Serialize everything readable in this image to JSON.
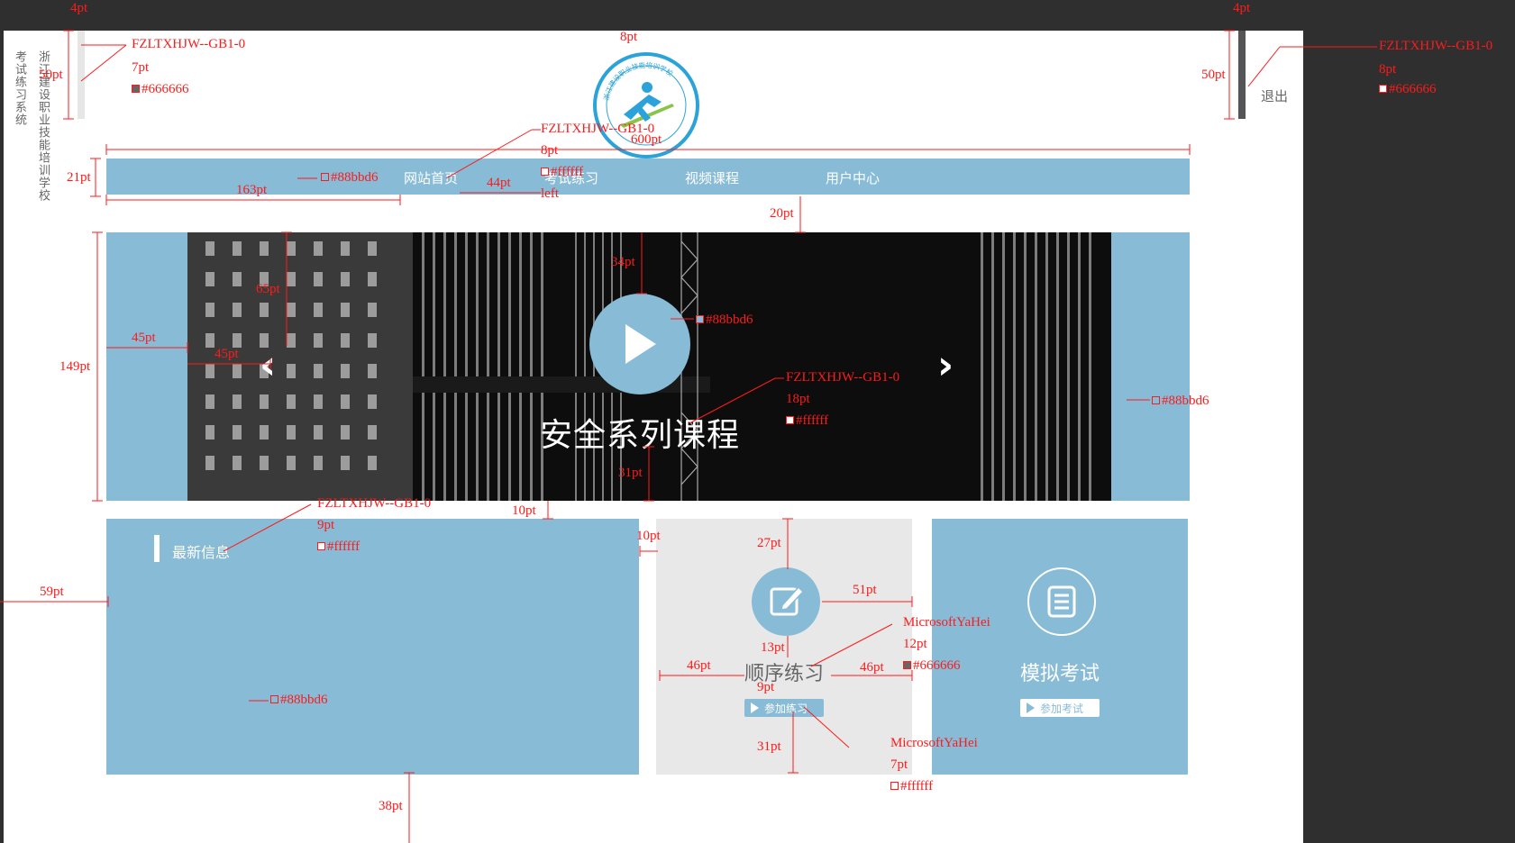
{
  "side": {
    "system_name": "考试练习系统",
    "school_name": "浙江建设职业技能培训学校",
    "logout_label": "退出"
  },
  "logo": {
    "ring_text": "浙江建设职业技能培训学校",
    "ring_text_en": "ZHEJIANG JIANSHE"
  },
  "nav": {
    "items": [
      "网站首页",
      "考试练习",
      "视频课程",
      "用户中心"
    ]
  },
  "banner": {
    "title": "安全系列课程",
    "prev_glyph": "‹",
    "next_glyph": "›"
  },
  "news": {
    "title": "最新信息"
  },
  "practice": {
    "title": "顺序练习",
    "button": "参加练习"
  },
  "exam": {
    "title": "模拟考试",
    "button": "参加考试"
  },
  "colors": {
    "accent": "#88bbd6",
    "text_gray": "#666666",
    "white": "#ffffff",
    "panel_gray": "#e8e8e8"
  },
  "annotations": {
    "font_a": "FZLTXHJW--GB1-0",
    "font_b": "MicrosoftYaHei",
    "left_align": "left",
    "c_666": "#666666",
    "c_fff": "#ffffff",
    "c_88b": "#88bbd6",
    "m_4pt": "4pt",
    "m_50pt": "50pt",
    "m_7pt": "7pt",
    "m_8pt": "8pt",
    "m_600pt": "600pt",
    "m_21pt": "21pt",
    "m_163pt": "163pt",
    "m_44pt": "44pt",
    "m_20pt": "20pt",
    "m_149pt": "149pt",
    "m_45pt": "45pt",
    "m_65pt": "65pt",
    "m_34pt": "34pt",
    "m_18pt": "18pt",
    "m_31pt": "31pt",
    "m_10pt": "10pt",
    "m_9pt": "9pt",
    "m_59pt": "59pt",
    "m_27pt": "27pt",
    "m_51pt": "51pt",
    "m_13pt": "13pt",
    "m_46pt": "46pt",
    "m_12pt": "12pt",
    "m_38pt": "38pt"
  }
}
